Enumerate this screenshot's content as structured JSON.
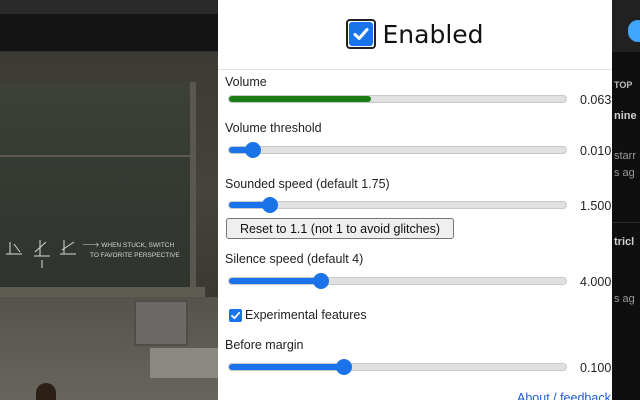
{
  "popup": {
    "enabled_label": "Enabled",
    "enabled_checked": true,
    "accent_color": "#1a73e8",
    "volume_color": "#1c7d14",
    "controls": {
      "volume": {
        "label": "Volume",
        "value_text": "0.063",
        "level": 0.42
      },
      "volume_threshold": {
        "label": "Volume threshold",
        "value_text": "0.010",
        "level": 0.07
      },
      "sounded_speed": {
        "label": "Sounded speed (default 1.75)",
        "value_text": "1.500",
        "level": 0.12
      },
      "silence_speed": {
        "label": "Silence speed (default 4)",
        "value_text": "4.000",
        "level": 0.27
      },
      "before_margin": {
        "label": "Before margin",
        "value_text": "0.100",
        "level": 0.34
      }
    },
    "reset_button_label": "Reset to 1.1 (not 1 to avoid glitches)",
    "experimental": {
      "label": "Experimental features",
      "checked": true
    },
    "footer_link": "About / feedback"
  },
  "background": {
    "chalk_text": "if WHEN STUCK, SWITCH TO FAVORITE PERSPECTIVE",
    "right_sidebar": {
      "line1": "TOP",
      "line2": "nine",
      "line3": "starr",
      "line4": "s ag",
      "line5": "tricl",
      "line6": "s ag"
    }
  }
}
